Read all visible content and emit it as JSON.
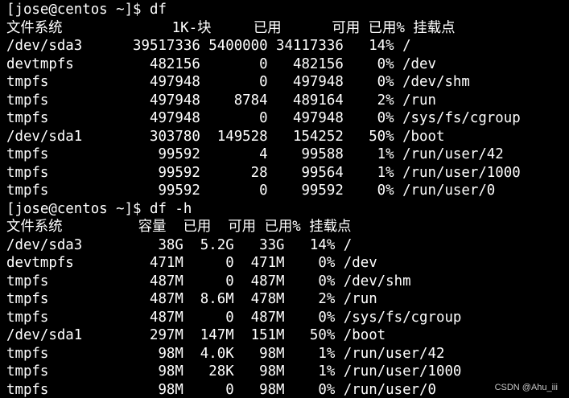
{
  "terminal": {
    "background": "#000000",
    "foreground": "#ffffff",
    "lines": [
      "[jose@centos ~]$ df",
      "文件系统             1K-块     已用      可用 已用% 挂载点",
      "/dev/sda3      39517336 5400000 34117336   14% /",
      "devtmpfs         482156       0   482156    0% /dev",
      "tmpfs            497948       0   497948    0% /dev/shm",
      "tmpfs            497948    8784   489164    2% /run",
      "tmpfs            497948       0   497948    0% /sys/fs/cgroup",
      "/dev/sda1        303780  149528   154252   50% /boot",
      "tmpfs             99592       4    99588    1% /run/user/42",
      "tmpfs             99592      28    99564    1% /run/user/1000",
      "tmpfs             99592       0    99592    0% /run/user/0",
      "[jose@centos ~]$ df -h",
      "文件系统         容量  已用  可用 已用% 挂载点",
      "/dev/sda3         38G  5.2G   33G   14% /",
      "devtmpfs         471M     0  471M    0% /dev",
      "tmpfs            487M     0  487M    0% /dev/shm",
      "tmpfs            487M  8.6M  478M    2% /run",
      "tmpfs            487M     0  487M    0% /sys/fs/cgroup",
      "/dev/sda1        297M  147M  151M   50% /boot",
      "tmpfs             98M  4.0K   98M    1% /run/user/42",
      "tmpfs             98M   28K   98M    1% /run/user/1000",
      "tmpfs             98M     0   98M    0% /run/user/0"
    ]
  },
  "watermark": "CSDN @Ahu_iii"
}
